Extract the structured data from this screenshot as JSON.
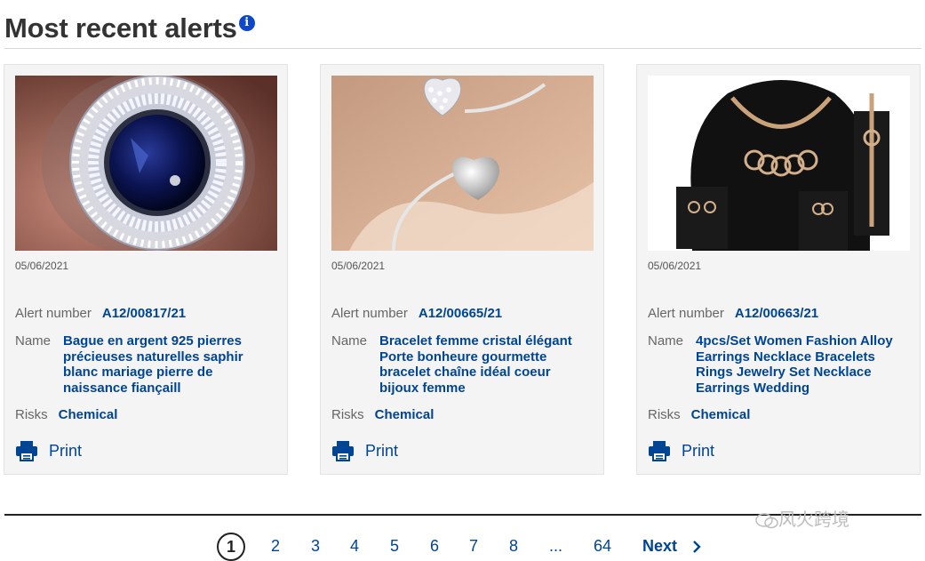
{
  "header": {
    "title": "Most recent alerts",
    "info_glyph": "i"
  },
  "labels": {
    "alert_number": "Alert number",
    "name": "Name",
    "risks": "Risks",
    "print": "Print"
  },
  "alerts": [
    {
      "image": "sapphire-ring",
      "date": "05/06/2021",
      "alert_number": "A12/00817/21",
      "name": "Bague en argent 925 pierres précieuses naturelles saphir blanc mariage pierre de naissance fiançaill",
      "risks": "Chemical"
    },
    {
      "image": "heart-bangle",
      "date": "05/06/2021",
      "alert_number": "A12/00665/21",
      "name": "Bracelet femme cristal élégant Porte bonheure gourmette bracelet chaîne idéal coeur bijoux femme",
      "risks": "Chemical"
    },
    {
      "image": "jewelry-set",
      "date": "05/06/2021",
      "alert_number": "A12/00663/21",
      "name": "4pcs/Set Women Fashion Alloy Earrings Necklace Bracelets Rings Jewelry Set Necklace Earrings Wedding",
      "risks": "Chemical"
    }
  ],
  "pagination": {
    "current": "1",
    "pages": [
      "2",
      "3",
      "4",
      "5",
      "6",
      "7",
      "8"
    ],
    "ellipsis": "...",
    "last": "64",
    "next_label": "Next"
  },
  "watermark": {
    "text": "风火跨境",
    "icon": "wechat-icon"
  },
  "colors": {
    "link": "#004494",
    "card_bg": "#f4f4f4",
    "info_icon": "#0e47cb"
  }
}
